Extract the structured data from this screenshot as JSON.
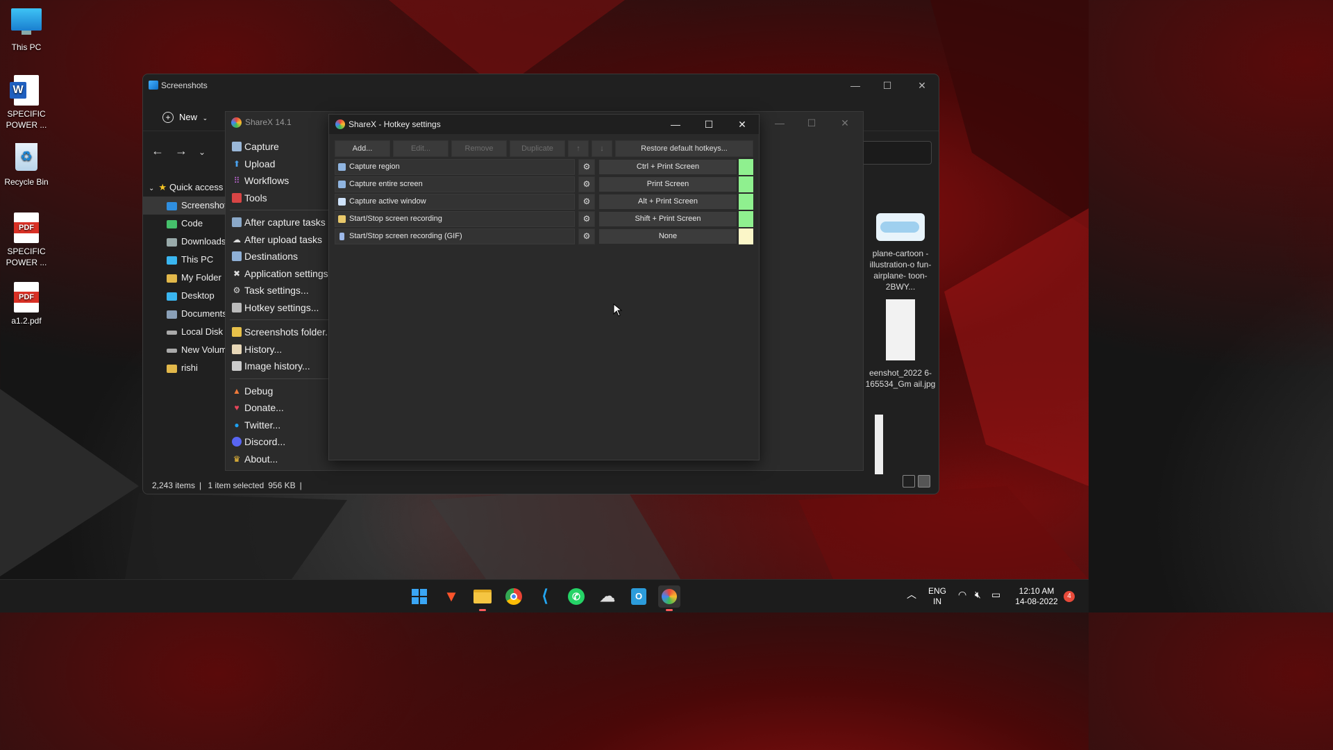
{
  "desktop": {
    "icons": [
      {
        "label": "This PC",
        "icon": "this-pc-icon"
      },
      {
        "label": "SPECIFIC POWER ...",
        "icon": "word-doc-icon"
      },
      {
        "label": "Recycle Bin",
        "icon": "recycle-bin-icon"
      },
      {
        "label": "SPECIFIC POWER ...",
        "icon": "pdf-icon"
      },
      {
        "label": "a1.2.pdf",
        "icon": "pdf-icon"
      }
    ]
  },
  "explorer": {
    "title": "Screenshots",
    "new_label": "New",
    "tree": [
      {
        "label": "Quick access",
        "icon": "star-icon"
      },
      {
        "label": "Screenshots",
        "icon": "screenshots-folder-icon"
      },
      {
        "label": "Code",
        "icon": "code-folder-icon"
      },
      {
        "label": "Downloads",
        "icon": "downloads-icon"
      },
      {
        "label": "This PC",
        "icon": "pc-icon"
      },
      {
        "label": "My Folder",
        "icon": "folder-icon"
      },
      {
        "label": "Desktop",
        "icon": "desktop-icon"
      },
      {
        "label": "Documents",
        "icon": "documents-icon"
      },
      {
        "label": "Local Disk (C",
        "icon": "drive-icon"
      },
      {
        "label": "New Volume",
        "icon": "drive-icon"
      },
      {
        "label": "rishi",
        "icon": "folder-icon"
      }
    ],
    "thumbnails": [
      {
        "label": "plane-cartoon -illustration-o fun-airplane- toon-2BWY..."
      },
      {
        "label": "eenshot_2022 6-165534_Gm ail.jpg"
      }
    ],
    "status": {
      "items": "2,243 items",
      "selected": "1 item selected",
      "size": "956 KB"
    }
  },
  "sharex": {
    "title": "ShareX 14.1",
    "menu": [
      {
        "label": "Capture",
        "icon": "capture-icon"
      },
      {
        "label": "Upload",
        "icon": "upload-icon"
      },
      {
        "label": "Workflows",
        "icon": "workflows-icon"
      },
      {
        "label": "Tools",
        "icon": "tools-icon"
      },
      {
        "label": "After capture tasks",
        "icon": "after-capture-icon"
      },
      {
        "label": "After upload tasks",
        "icon": "after-upload-icon"
      },
      {
        "label": "Destinations",
        "icon": "destinations-icon"
      },
      {
        "label": "Application settings...",
        "icon": "app-settings-icon"
      },
      {
        "label": "Task settings...",
        "icon": "task-settings-icon"
      },
      {
        "label": "Hotkey settings...",
        "icon": "hotkey-settings-icon"
      },
      {
        "label": "Screenshots folder...",
        "icon": "screenshots-folder-icon"
      },
      {
        "label": "History...",
        "icon": "history-icon"
      },
      {
        "label": "Image history...",
        "icon": "image-history-icon"
      },
      {
        "label": "Debug",
        "icon": "debug-icon"
      },
      {
        "label": "Donate...",
        "icon": "heart-icon"
      },
      {
        "label": "Twitter...",
        "icon": "twitter-icon"
      },
      {
        "label": "Discord...",
        "icon": "discord-icon"
      },
      {
        "label": "About...",
        "icon": "about-icon"
      }
    ]
  },
  "hotkey_dialog": {
    "title": "ShareX - Hotkey settings",
    "toolbar": {
      "add": "Add...",
      "edit": "Edit...",
      "remove": "Remove",
      "duplicate": "Duplicate",
      "up": "↑",
      "down": "↓",
      "restore": "Restore default hotkeys..."
    },
    "rows": [
      {
        "description": "Capture region",
        "hotkey": "Ctrl + Print Screen",
        "status_color": "#8ff08f"
      },
      {
        "description": "Capture entire screen",
        "hotkey": "Print Screen",
        "status_color": "#8ff08f"
      },
      {
        "description": "Capture active window",
        "hotkey": "Alt + Print Screen",
        "status_color": "#8ff08f"
      },
      {
        "description": "Start/Stop screen recording",
        "hotkey": "Shift + Print Screen",
        "status_color": "#8ff08f"
      },
      {
        "description": "Start/Stop screen recording (GIF)",
        "hotkey": "None",
        "status_color": "#fbf6c8"
      }
    ]
  },
  "taskbar": {
    "apps": [
      "start-icon",
      "brave-icon",
      "file-explorer-icon",
      "chrome-icon",
      "vscode-icon",
      "whatsapp-icon",
      "cloud-icon",
      "outlook-icon",
      "sharex-icon"
    ],
    "lang_top": "ENG",
    "lang_bottom": "IN",
    "time": "12:10 AM",
    "date": "14-08-2022",
    "notification_count": "4"
  }
}
